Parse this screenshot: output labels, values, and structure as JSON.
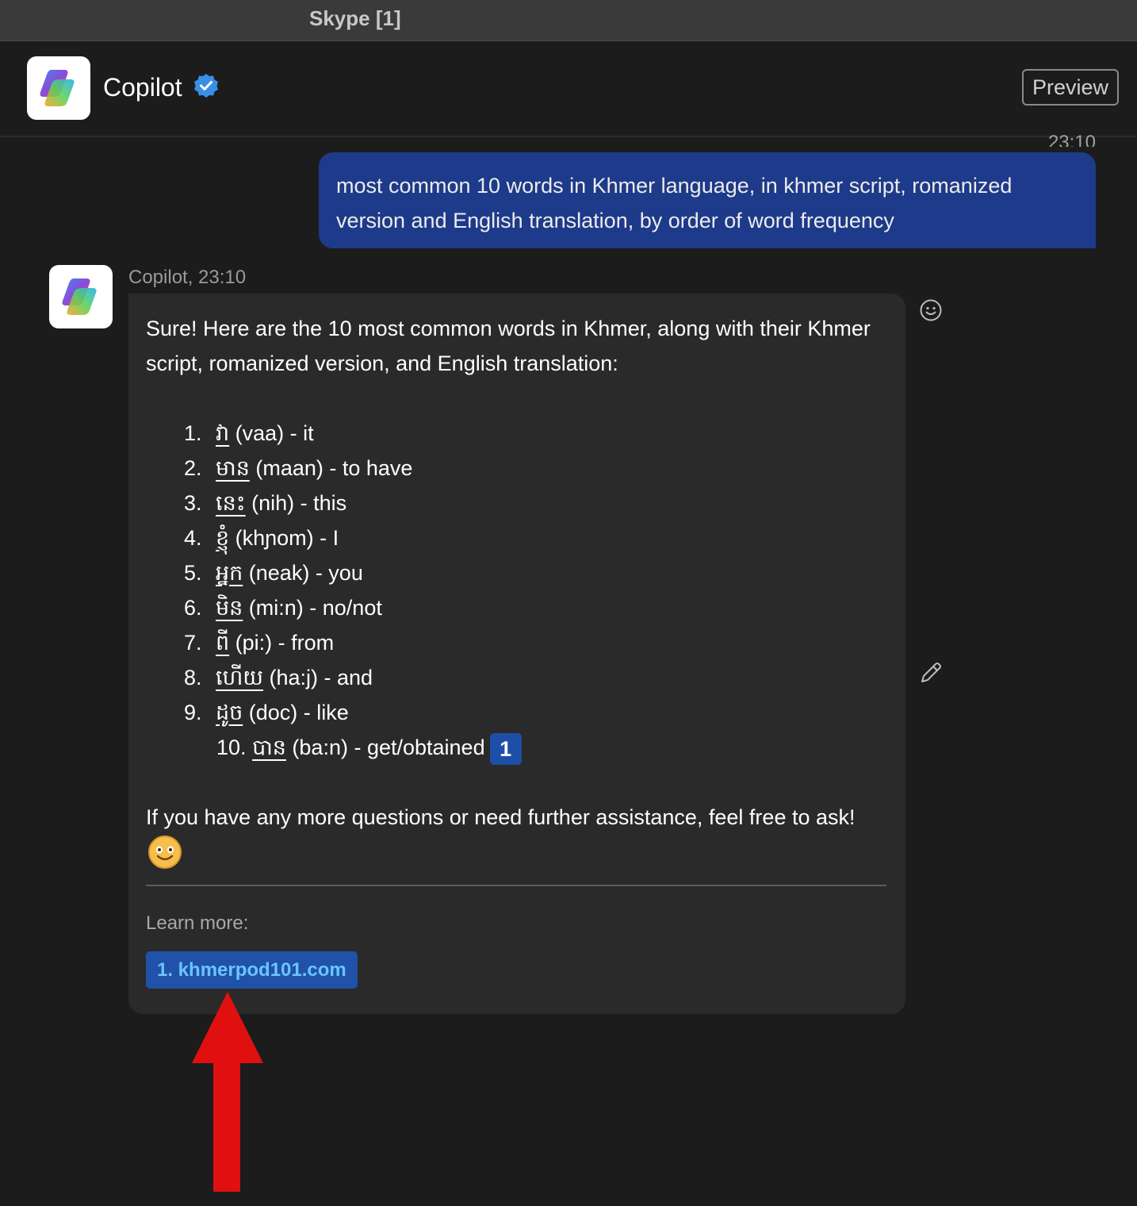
{
  "window": {
    "title": "Skype [1]"
  },
  "header": {
    "name": "Copilot",
    "preview_label": "Preview"
  },
  "user_message": {
    "time": "23:10",
    "text": "most common 10 words in Khmer language, in khmer script, romanized version and English translation, by order of word frequency"
  },
  "bot_message": {
    "meta": "Copilot, 23:10",
    "intro": "Sure! Here are the 10 most common words in Khmer, along with their Khmer script, romanized version, and English translation:",
    "items": [
      {
        "num": "1.",
        "khmer": "វា",
        "rest": " (vaa) - it"
      },
      {
        "num": "2.",
        "khmer": "មាន",
        "rest": " (maan) - to have"
      },
      {
        "num": "3.",
        "khmer": "នេះ",
        "rest": " (nih) - this"
      },
      {
        "num": "4.",
        "khmer": "ខ្ញុំ",
        "rest": " (khɲom) - I"
      },
      {
        "num": "5.",
        "khmer": "អ្នក",
        "rest": " (neak) - you"
      },
      {
        "num": "6.",
        "khmer": "មិន",
        "rest": " (mi:n) - no/not"
      },
      {
        "num": "7.",
        "khmer": "ពី",
        "rest": " (pi:) - from"
      },
      {
        "num": "8.",
        "khmer": "ហើយ",
        "rest": " (ha:j) - and"
      },
      {
        "num": "9.",
        "khmer": "ដូច",
        "rest": " (doc) - like"
      },
      {
        "num": "10.",
        "khmer": "បាន",
        "rest": " (ba:n) - get/obtained",
        "citation": "1"
      }
    ],
    "outro": "If you have any more questions or need further assistance, feel free to ask!",
    "emoji": "smiling-face-emoji",
    "learn_more_label": "Learn more:",
    "links": [
      {
        "label": "1. khmerpod101.com"
      }
    ]
  },
  "colors": {
    "background": "#1c1c1c",
    "user_bubble": "#1e3a8a",
    "bot_bubble": "#2a2a2a",
    "link_chip": "#1f52a8",
    "link_text": "#6cc4ff",
    "annotation_arrow": "#e01010",
    "verified_badge": "#3b8ee8"
  }
}
